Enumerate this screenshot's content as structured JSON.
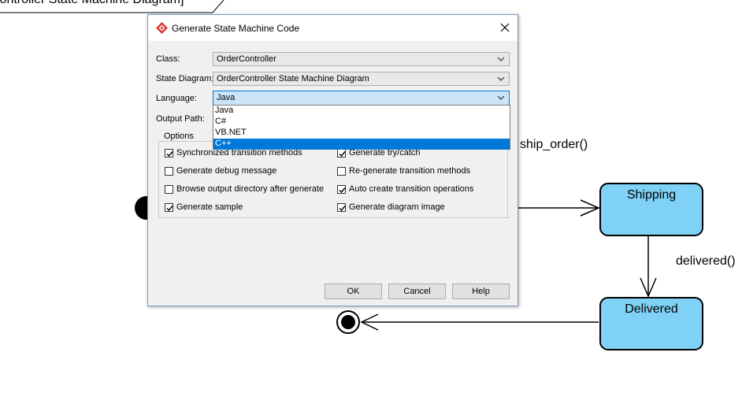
{
  "diagram": {
    "frame_title": "Controller State Machine Diagram]",
    "states": [
      {
        "name": "Shipping"
      },
      {
        "name": "Delivered"
      }
    ],
    "transitions": [
      {
        "label": "ship_order()"
      },
      {
        "label": "delivered()"
      }
    ]
  },
  "dialog": {
    "title": "Generate State Machine Code",
    "close_icon": "close-icon",
    "fields": {
      "class_label": "Class:",
      "class_value": "OrderController",
      "state_diagram_label": "State Diagram:",
      "state_diagram_value": "OrderController State Machine Diagram",
      "language_label": "Language:",
      "language_value": "Java",
      "output_path_label": "Output Path:"
    },
    "options_title": "Options",
    "options": [
      {
        "label": "Synchronized transition methods",
        "checked": true
      },
      {
        "label": "Generate try/catch",
        "checked": true
      },
      {
        "label": "Generate debug message",
        "checked": false
      },
      {
        "label": "Re-generate transition methods",
        "checked": false
      },
      {
        "label": "Browse output directory after generate",
        "checked": false
      },
      {
        "label": "Auto create transition operations",
        "checked": true
      },
      {
        "label": "Generate sample",
        "checked": true
      },
      {
        "label": "Generate diagram image",
        "checked": true
      }
    ],
    "buttons": {
      "ok": "OK",
      "cancel": "Cancel",
      "help": "Help"
    }
  },
  "language_dropdown": {
    "options": [
      "Java",
      "C#",
      "VB.NET",
      "C++"
    ],
    "highlighted": "C++"
  },
  "colors": {
    "state_fill": "#7fd1f5",
    "selection": "#0078d7",
    "combo_active": "#cce4f7"
  }
}
